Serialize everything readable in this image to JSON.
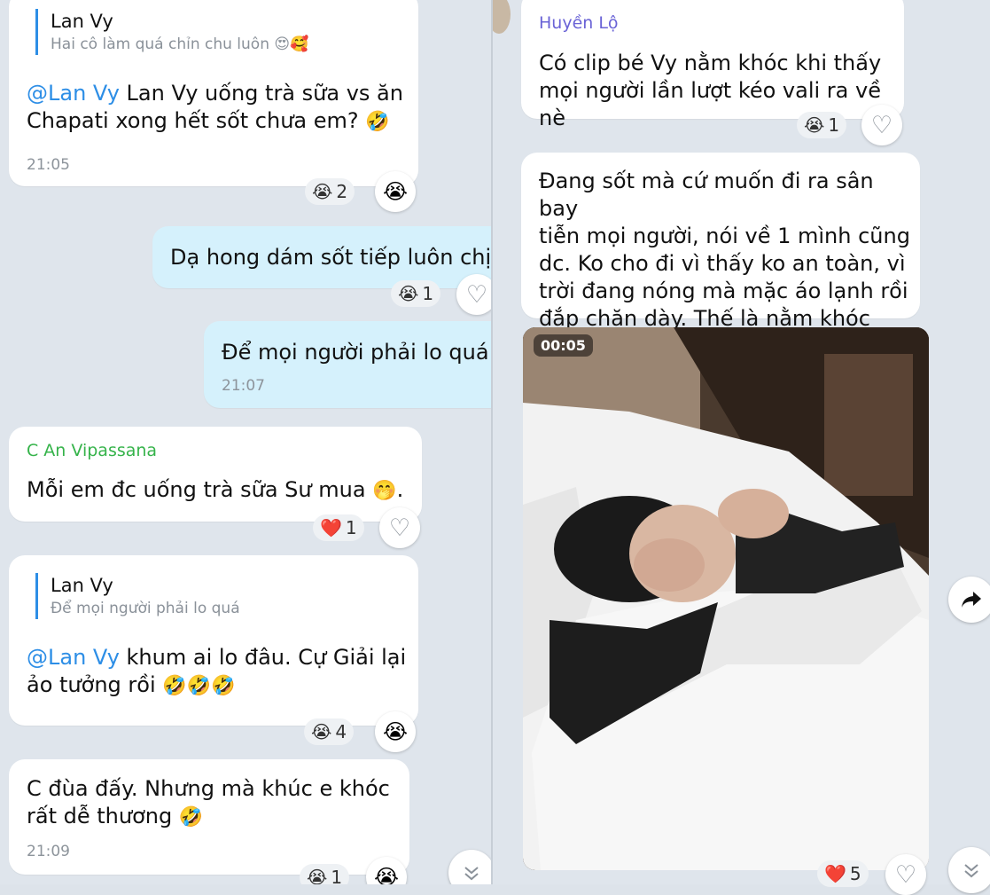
{
  "left": {
    "m1": {
      "quote_name": "Lan Vy",
      "quote_text": "Hai cô làm quá chỉn chu luôn",
      "quote_emoji": "😍🥰",
      "mention": "@Lan Vy",
      "text_a": " Lan Vy uống trà sữa vs ăn",
      "text_b": "Chapati xong hết sốt chưa em?",
      "emoji": "🤣",
      "time": "21:05",
      "react_emoji": "😭",
      "react_count": "2",
      "react_btn": "😭"
    },
    "m2": {
      "text": "Dạ hong dám sốt tiếp luôn chị",
      "react_emoji": "😭",
      "react_count": "1"
    },
    "m3": {
      "text": "Để mọi người phải lo quá",
      "time": "21:07"
    },
    "m4": {
      "sender": "C An Vipassana",
      "text": "Mỗi em đc uống trà sữa Sư mua",
      "emoji": "🤭",
      "tail": ".",
      "react_emoji": "❤️",
      "react_count": "1"
    },
    "m5": {
      "quote_name": "Lan Vy",
      "quote_text": "Để mọi người phải lo quá",
      "mention": "@Lan Vy",
      "text_a": " khum ai lo đâu. Cự Giải lại",
      "text_b": "ảo tưởng rồi",
      "emoji": "🤣🤣🤣",
      "react_emoji": "😭",
      "react_count": "4",
      "react_btn": "😭"
    },
    "m6": {
      "text_a": "C đùa đấy. Nhưng mà khúc e khóc",
      "text_b": "rất dễ thương",
      "emoji": "🤣",
      "time": "21:09",
      "react_emoji": "😭",
      "react_count": "1",
      "react_btn": "😭"
    }
  },
  "right": {
    "r1": {
      "sender": "Huyền Lộ",
      "text_a": "Có clip bé Vy nằm khóc khi thấy",
      "text_b": "mọi người lần lượt kéo vali ra về nè",
      "react_emoji": "😭",
      "react_count": "1"
    },
    "r2": {
      "line1": "Đang sốt mà cứ muốn đi ra sân bay",
      "line2": "tiễn mọi người, nói về 1 mình cũng",
      "line3": "dc. Ko cho đi vì thấy ko an toàn, vì",
      "line4": "trời đang nóng mà mặc áo lạnh rồi",
      "line5": "đắp chăn dày. Thế là nằm khóc"
    },
    "video": {
      "duration": "00:05",
      "react_emoji": "❤️",
      "react_count": "5"
    }
  },
  "icons": {
    "heart": "heart-outline-icon",
    "scroll": "chevron-double-down-icon",
    "share": "share-arrow-icon"
  },
  "colors": {
    "accent": "#2d8ee6",
    "outgoing": "#d5f1fc",
    "sender_green": "#35b34a",
    "sender_purple": "#6a63d6"
  }
}
